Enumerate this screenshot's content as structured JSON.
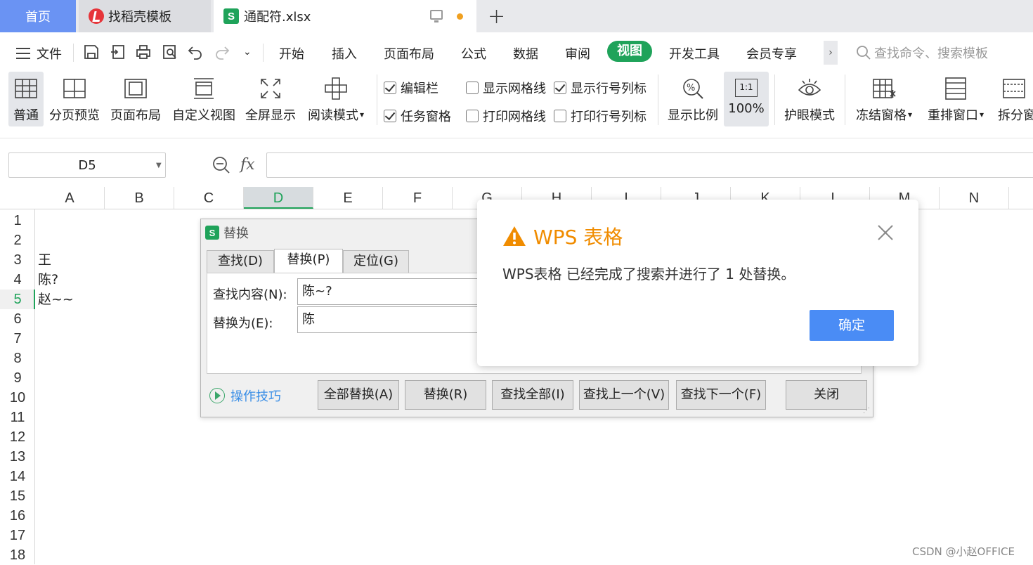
{
  "tabs": {
    "home": "首页",
    "daoke": "找稻壳模板",
    "file": "通配符.xlsx"
  },
  "menu": {
    "file": "文件",
    "items": [
      "开始",
      "插入",
      "页面布局",
      "公式",
      "数据",
      "审阅",
      "视图",
      "开发工具",
      "会员专享"
    ],
    "active": "视图",
    "more": "›",
    "search_placeholder": "查找命令、搜索模板"
  },
  "ribbon": {
    "normal": "普通",
    "page_break": "分页预览",
    "page_layout": "页面布局",
    "custom_view": "自定义视图",
    "fullscreen": "全屏显示",
    "reading_mode": "阅读模式",
    "edit_bar": "编辑栏",
    "task_pane": "任务窗格",
    "show_gridlines": "显示网格线",
    "print_gridlines": "打印网格线",
    "show_headings": "显示行号列标",
    "print_headings": "打印行号列标",
    "zoom": "显示比例",
    "zoom_100": "100%",
    "zoom_100_icon": "1:1",
    "eye_care": "护眼模式",
    "freeze": "冻结窗格",
    "rearrange": "重排窗口",
    "split": "拆分窗",
    "checks": {
      "edit_bar": true,
      "task_pane": true,
      "show_gridlines": false,
      "print_gridlines": false,
      "show_headings": true,
      "print_headings": false
    }
  },
  "formula_bar": {
    "name_box": "D5",
    "fx": "fx",
    "content": ""
  },
  "grid": {
    "columns": [
      "A",
      "B",
      "C",
      "D",
      "E",
      "F",
      "G",
      "H",
      "I",
      "J",
      "K",
      "L",
      "M",
      "N"
    ],
    "selected_column": "D",
    "rows": [
      "1",
      "2",
      "3",
      "4",
      "5",
      "6",
      "7",
      "8",
      "9",
      "10",
      "11",
      "12",
      "13",
      "14",
      "15",
      "16",
      "17",
      "18"
    ],
    "selected_row": "5",
    "cells": {
      "A3": "王",
      "A4": "陈?",
      "A5": "赵~~"
    }
  },
  "replace_dialog": {
    "title": "替换",
    "tabs": [
      "查找(D)",
      "替换(P)",
      "定位(G)"
    ],
    "active_tab": "替换(P)",
    "find_label": "查找内容(N):",
    "find_value": "陈~?",
    "replace_label": "替换为(E):",
    "replace_value": "陈",
    "tips": "操作技巧",
    "buttons": [
      "全部替换(A)",
      "替换(R)",
      "查找全部(I)",
      "查找上一个(V)",
      "查找下一个(F)",
      "关闭"
    ]
  },
  "message_box": {
    "title": "WPS 表格",
    "text": "WPS表格 已经完成了搜索并进行了 1 处替换。",
    "ok": "确定"
  },
  "watermark": "CSDN @小赵OFFICE",
  "colors": {
    "accent_green": "#1fa35a",
    "home_tab_blue": "#6a93f3",
    "ok_blue": "#4a8cf5",
    "warning_orange": "#f08c00"
  }
}
